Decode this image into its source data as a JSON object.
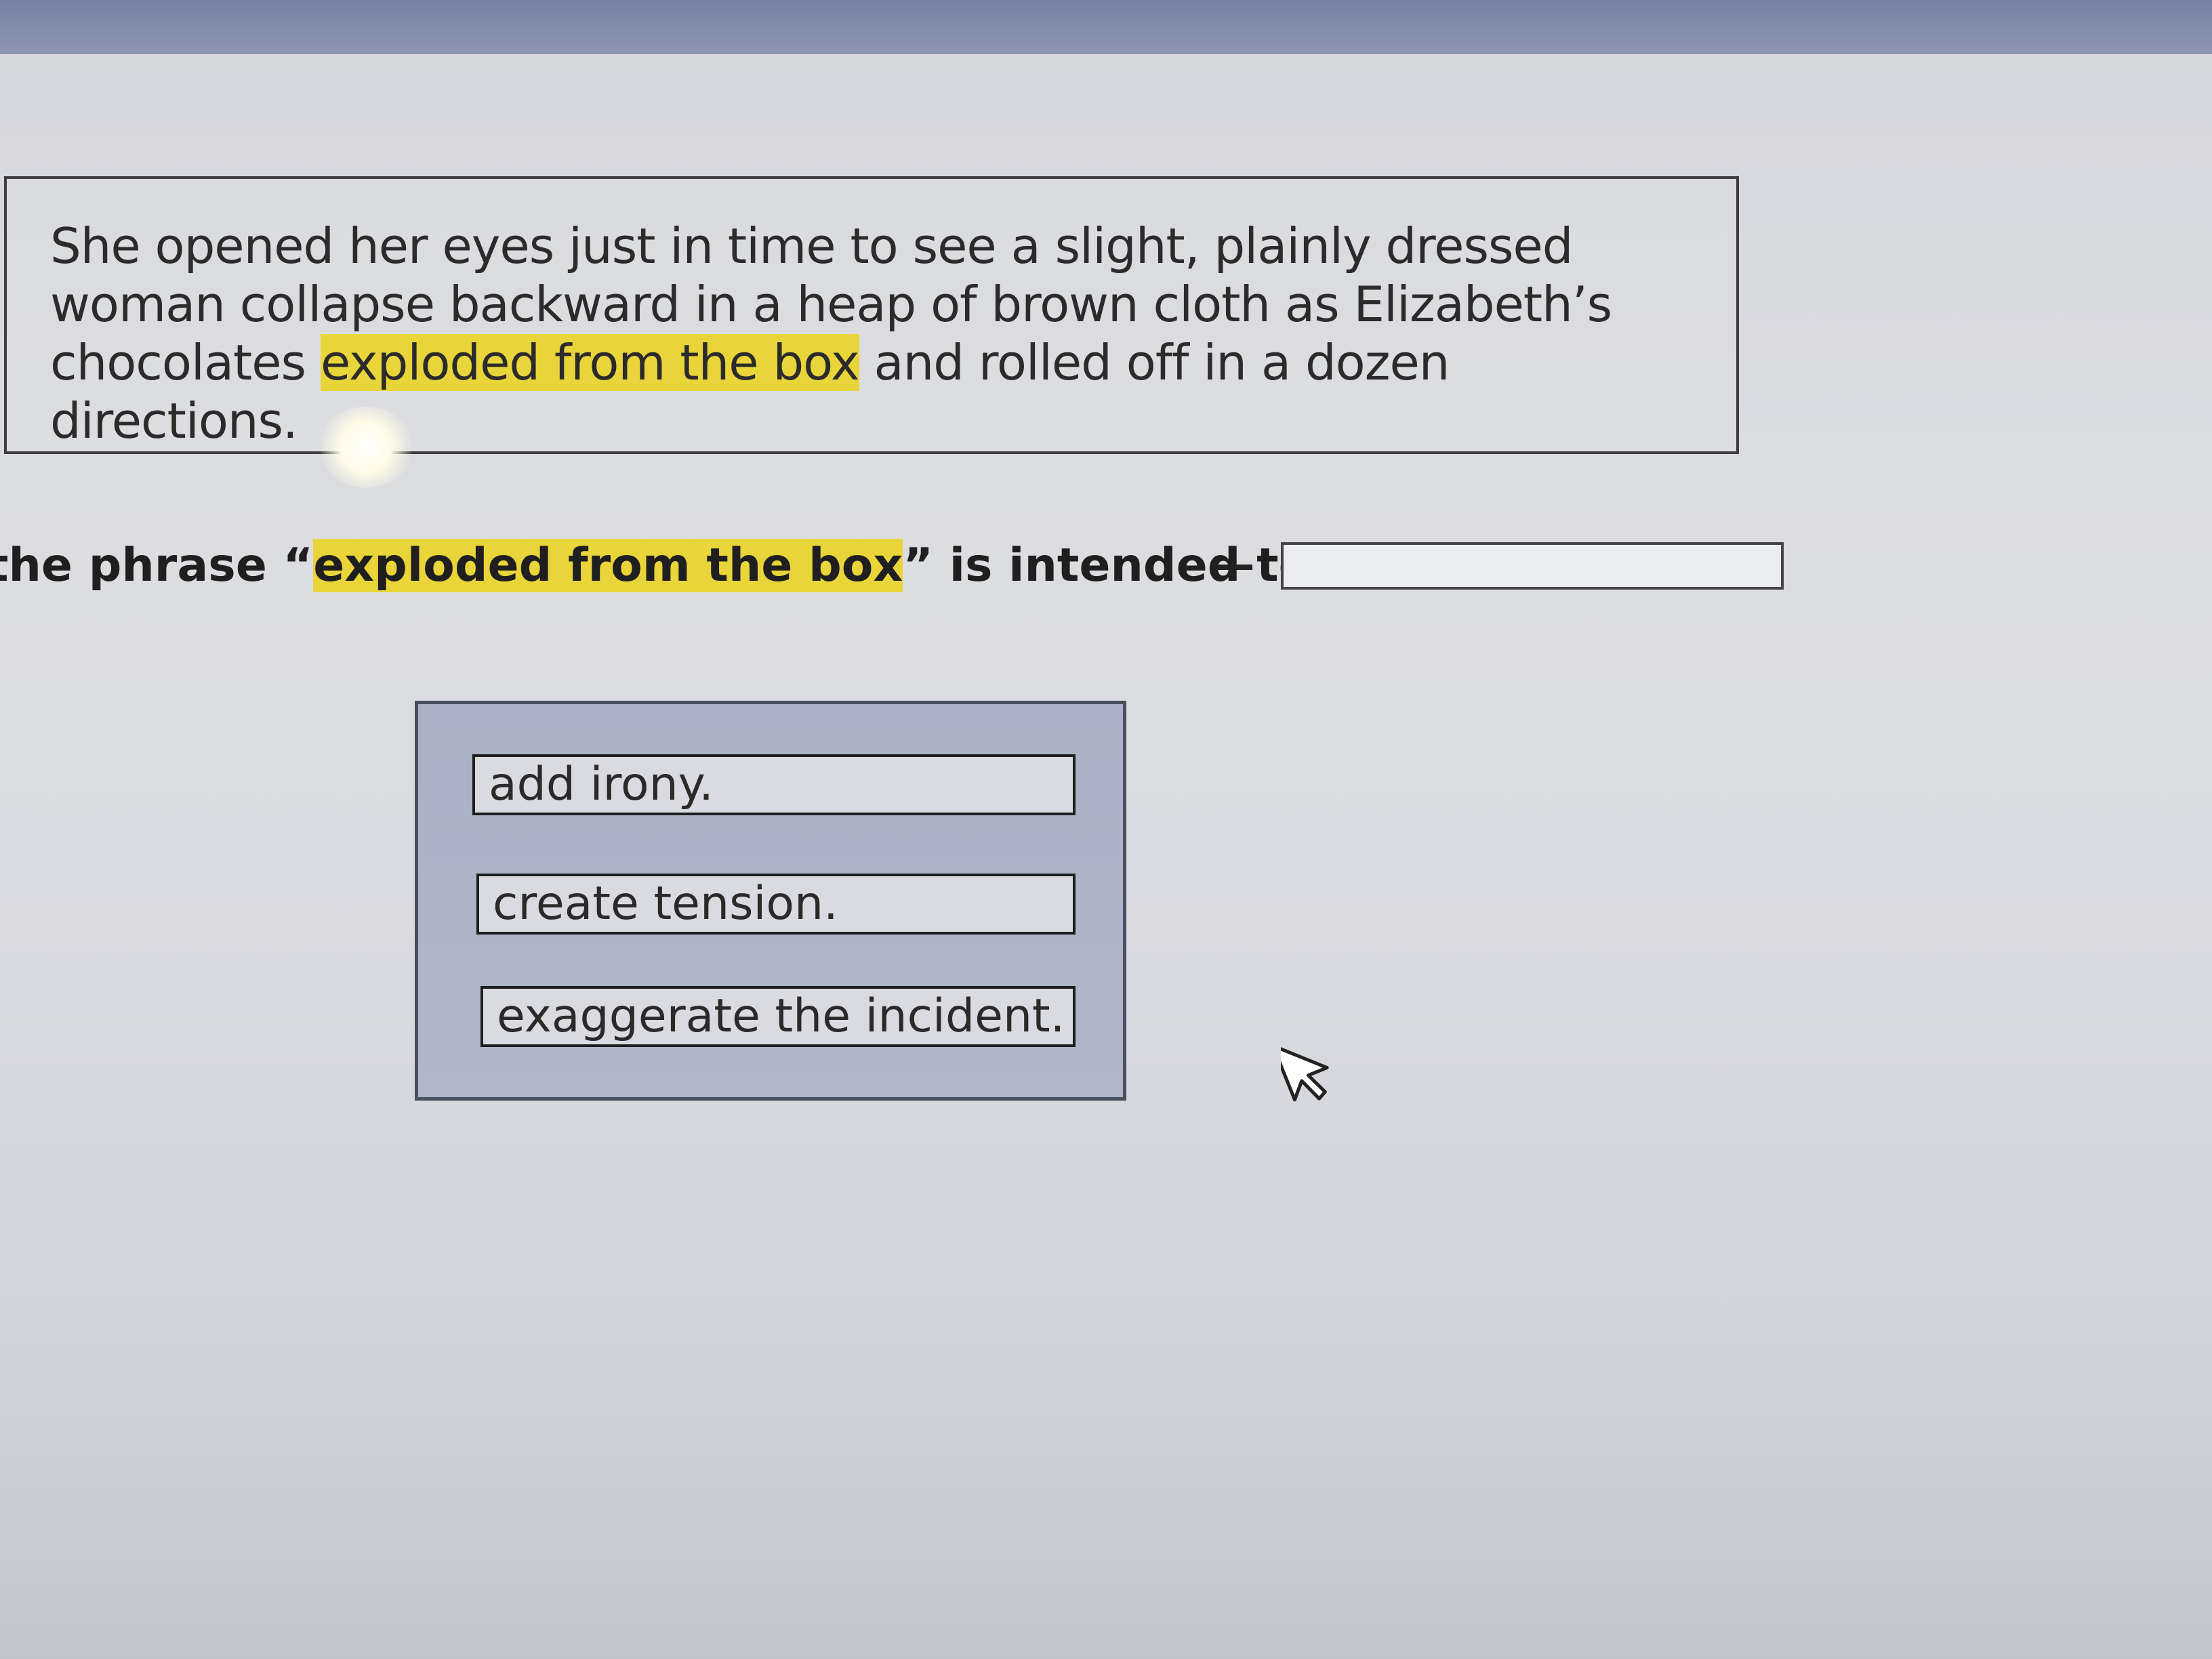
{
  "passage": {
    "before_highlight": "She opened her eyes just in time to see a slight, plainly dressed woman collapse backward in a heap of brown cloth as Elizabeth’s chocolates ",
    "highlight": "exploded from the box",
    "after_highlight": " and rolled off in a dozen directions."
  },
  "question": {
    "prefix": "the phrase “",
    "highlight": "exploded from the box",
    "suffix": "” is intended to"
  },
  "choices": [
    {
      "label": "add irony."
    },
    {
      "label": "create tension."
    },
    {
      "label": "exaggerate the incident."
    }
  ],
  "colors": {
    "highlight": "#e9d53a",
    "panel": "#aab1c6"
  },
  "icons": {
    "cursor": "mouse-pointer-icon"
  }
}
